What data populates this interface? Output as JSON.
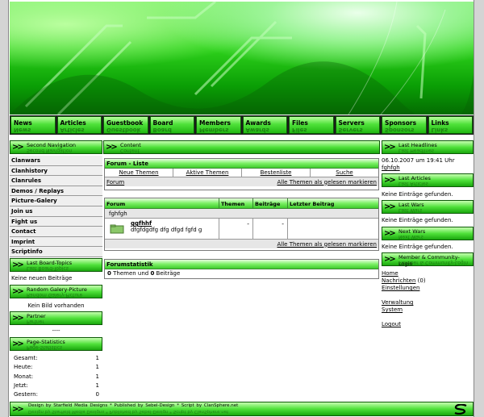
{
  "nav": [
    {
      "label": "News"
    },
    {
      "label": "Articles"
    },
    {
      "label": "Guestbook"
    },
    {
      "label": "Board"
    },
    {
      "label": "Members"
    },
    {
      "label": "Awards"
    },
    {
      "label": "Files"
    },
    {
      "label": "Servers"
    },
    {
      "label": "Sponsors"
    },
    {
      "label": "Links"
    }
  ],
  "left": {
    "second_nav": "Second Navigation",
    "items": [
      "Clanwars",
      "Clanhistory",
      "Clanrules",
      "Demos / Replays",
      "Picture-Galery",
      "Join us",
      "Fight us",
      "Contact",
      "Imprint",
      "Scriptinfo"
    ],
    "board_topics": "Last Board-Topics",
    "no_posts": "Keine neuen Beiträge",
    "random_pic": "Random Galery-Picture",
    "no_image": "Kein Bild vorhanden",
    "partner": "Partner",
    "partner_text": "----",
    "page_stats": "Page-Statistics",
    "stats": [
      {
        "label": "Gesamt:",
        "value": "1"
      },
      {
        "label": "Heute:",
        "value": "1"
      },
      {
        "label": "Monat:",
        "value": "1"
      },
      {
        "label": "Jetzt:",
        "value": "1"
      },
      {
        "label": "Gestern:",
        "value": "0"
      }
    ]
  },
  "content": {
    "header": "Content",
    "forum_list": "Forum - Liste",
    "tabs": [
      "Neue Themen",
      "Aktive Themen",
      "Bestenliste",
      "Suche"
    ],
    "forum_link": "Forum",
    "mark_read": "Alle Themen als gelesen markieren",
    "cols": [
      "Forum",
      "Themen",
      "Beiträge",
      "Letzter Beitrag"
    ],
    "category": "fghfgh",
    "forum_name": "ggfhhf",
    "forum_desc": "dfgfdgdfg dfg dfgd fgfd g",
    "themes": "-",
    "posts": "-",
    "mark_read2": "Alle Themen als gelesen markieren",
    "stats_title": "Forumstatistik",
    "stats_themes": "0",
    "stats_themes_label": " Themen und ",
    "stats_posts": "0",
    "stats_posts_label": " Beiträge"
  },
  "right": {
    "headlines": "Last Headlines",
    "date": "06.10.2007 um 19:41 Uhr",
    "headline": "fghfgh",
    "articles": "Last Articles",
    "no_entries1": "Keine Einträge gefunden.",
    "wars": "Last Wars",
    "no_entries2": "Keine Einträge gefunden.",
    "next_wars": "Next Wars",
    "no_entries3": "Keine Einträge gefunden.",
    "login": "Member & Community-Login",
    "links": [
      "Home",
      "Nachrichten",
      "Einstellungen"
    ],
    "msg_count": " (0)",
    "links2": [
      "Verwaltung",
      "System"
    ],
    "logout": "Logout"
  },
  "footer": {
    "text": "Design by Starfield Media Designs   *   Published by Sebel-Design   *   Script by ClanSphere.net"
  }
}
